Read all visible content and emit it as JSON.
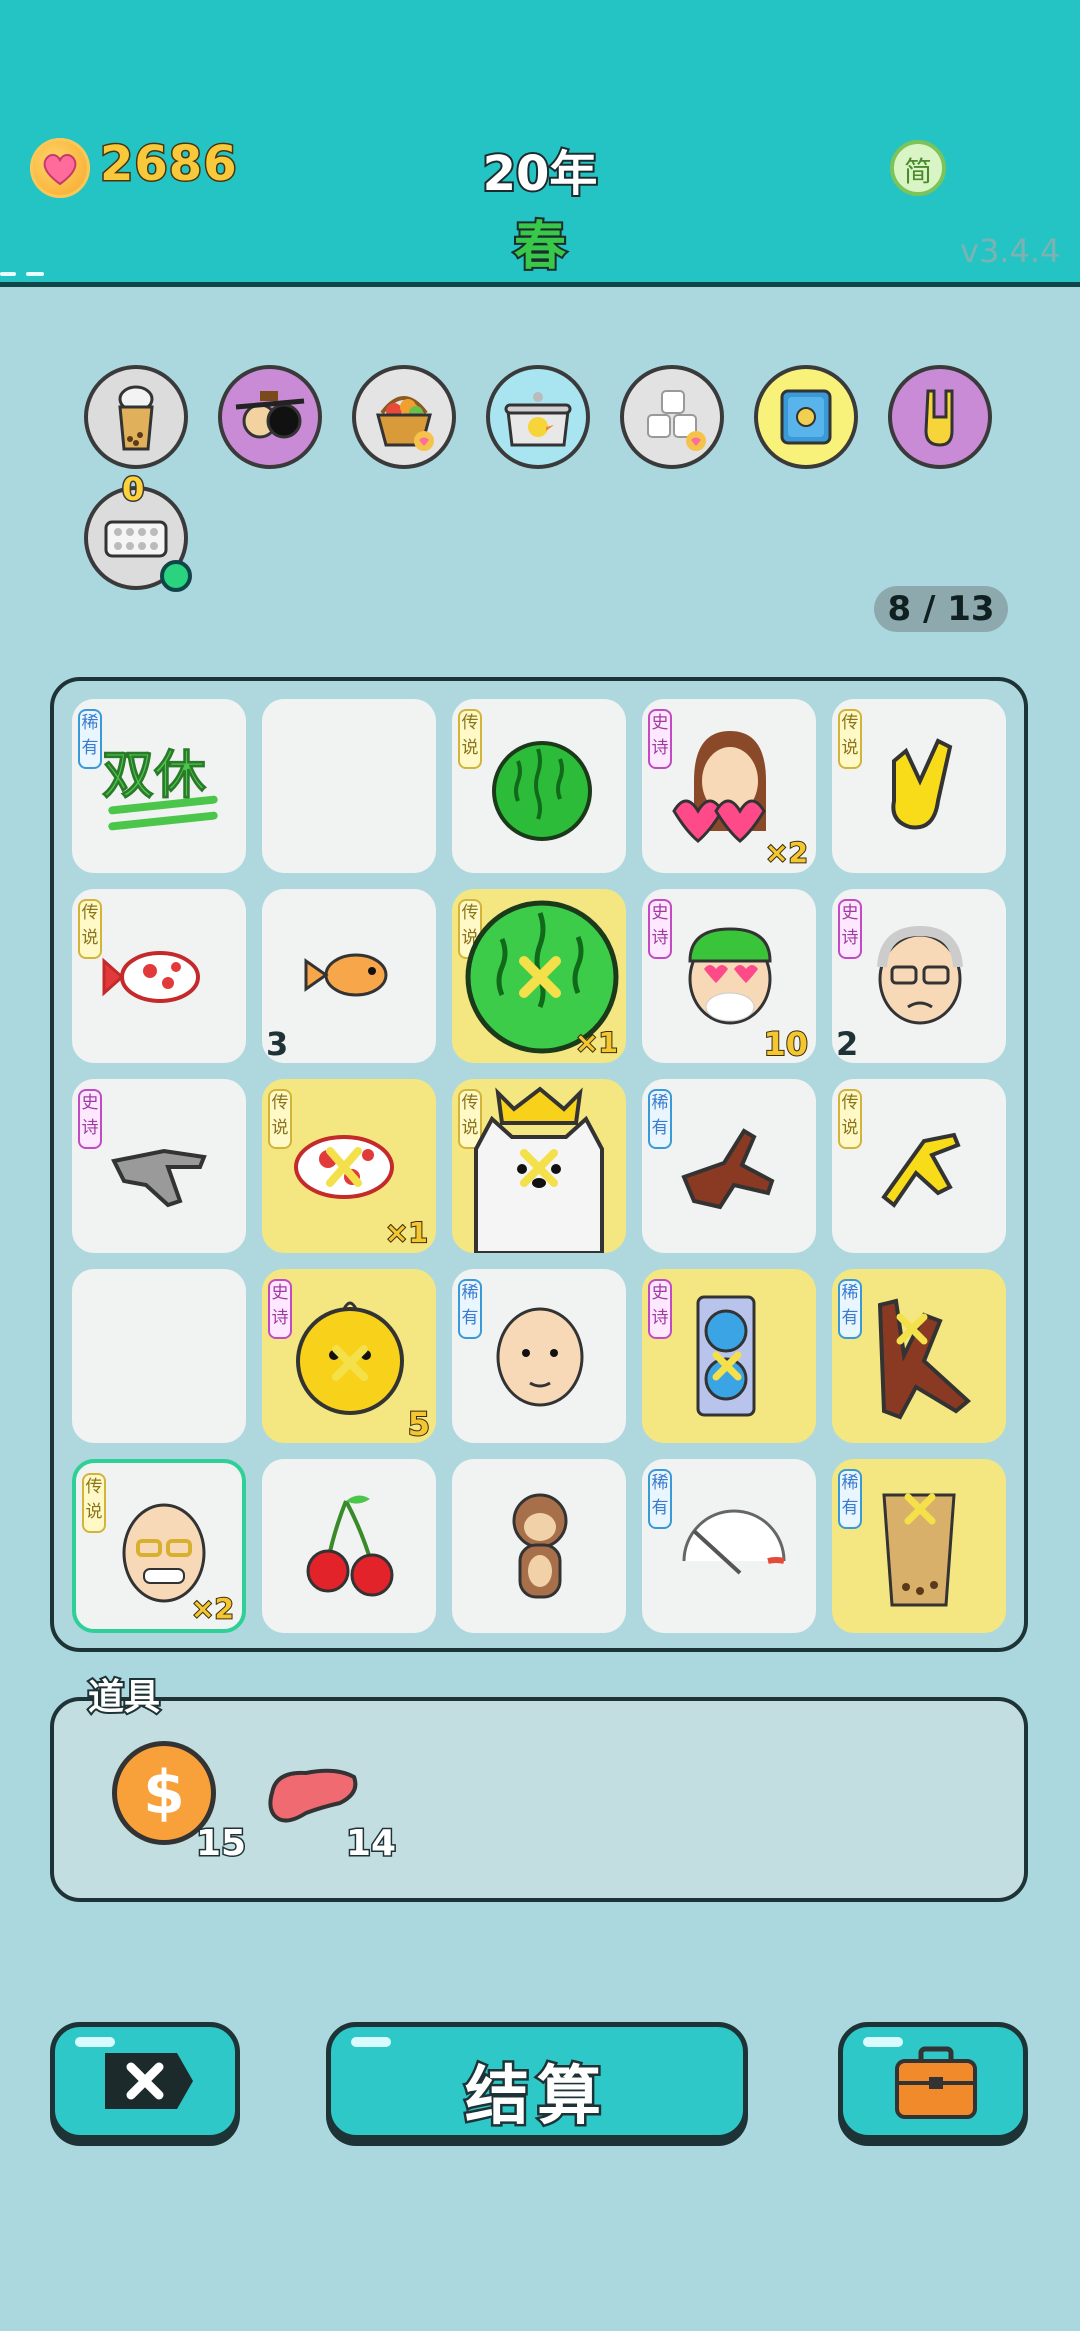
{
  "header": {
    "coins": "2686",
    "year": "20年",
    "season": "春",
    "lang_label": "简",
    "version": "v3.4.4"
  },
  "colors": {
    "header_bg": "#25c4c4",
    "body_bg": "#abd8df",
    "gold_cell": "#f4e781",
    "accent_green": "#38c84a"
  },
  "relics": {
    "items": [
      {
        "icon": "bubble-tea-cup-icon"
      },
      {
        "icon": "eye-patch-icon"
      },
      {
        "icon": "fruit-basket-icon"
      },
      {
        "icon": "duck-pot-icon"
      },
      {
        "icon": "sugar-cubes-icon"
      },
      {
        "icon": "safe-icon"
      },
      {
        "icon": "rock-hand-icon"
      },
      {
        "icon": "egg-tray-icon",
        "badge": "0"
      }
    ],
    "counter": "8 / 13"
  },
  "board": {
    "cells": [
      {
        "rarity": "稀有",
        "item": "double-rest-text",
        "label": "双休"
      },
      {
        "rarity": "",
        "item": "empty"
      },
      {
        "rarity": "传说",
        "item": "watermelon-icon"
      },
      {
        "rarity": "史诗",
        "item": "girl-hearts-icon",
        "mult": "×2"
      },
      {
        "rarity": "传说",
        "item": "rock-hand-yellow-icon"
      },
      {
        "rarity": "传说",
        "item": "koi-fish-icon"
      },
      {
        "rarity": "",
        "item": "goldfish-icon",
        "num": "3"
      },
      {
        "rarity": "传说",
        "item": "big-watermelon-icon",
        "mult": "×1",
        "gold": true
      },
      {
        "rarity": "史诗",
        "item": "heart-eyes-face-icon",
        "num": "10"
      },
      {
        "rarity": "史诗",
        "item": "grandpa-face-icon",
        "num": "2"
      },
      {
        "rarity": "史诗",
        "item": "gray-pointing-hand-icon"
      },
      {
        "rarity": "传说",
        "item": "koi-fish-icon",
        "mult": "×1",
        "gold": true
      },
      {
        "rarity": "传说",
        "item": "crowned-cat-icon",
        "gold": true
      },
      {
        "rarity": "稀有",
        "item": "brown-hand-icon"
      },
      {
        "rarity": "传说",
        "item": "yellow-pointing-hand-icon"
      },
      {
        "rarity": "",
        "item": "empty"
      },
      {
        "rarity": "史诗",
        "item": "chick-icon",
        "num": "5",
        "gold": true
      },
      {
        "rarity": "稀有",
        "item": "bald-man-icon"
      },
      {
        "rarity": "史诗",
        "item": "graphics-card-icon",
        "gold": true
      },
      {
        "rarity": "稀有",
        "item": "brown-rock-hand-icon",
        "gold": true
      },
      {
        "rarity": "传说",
        "item": "grinning-grandpa-icon",
        "mult": "×2",
        "selected": true
      },
      {
        "rarity": "",
        "item": "cherries-icon"
      },
      {
        "rarity": "",
        "item": "monkey-icon"
      },
      {
        "rarity": "稀有",
        "item": "gauge-icon"
      },
      {
        "rarity": "稀有",
        "item": "bubble-tea-icon",
        "gold": true
      }
    ]
  },
  "tools": {
    "label": "道具",
    "items": [
      {
        "icon": "dollar-coin-icon",
        "count": "15"
      },
      {
        "icon": "liver-icon",
        "count": "14"
      }
    ]
  },
  "buttons": {
    "settle": "结算"
  }
}
